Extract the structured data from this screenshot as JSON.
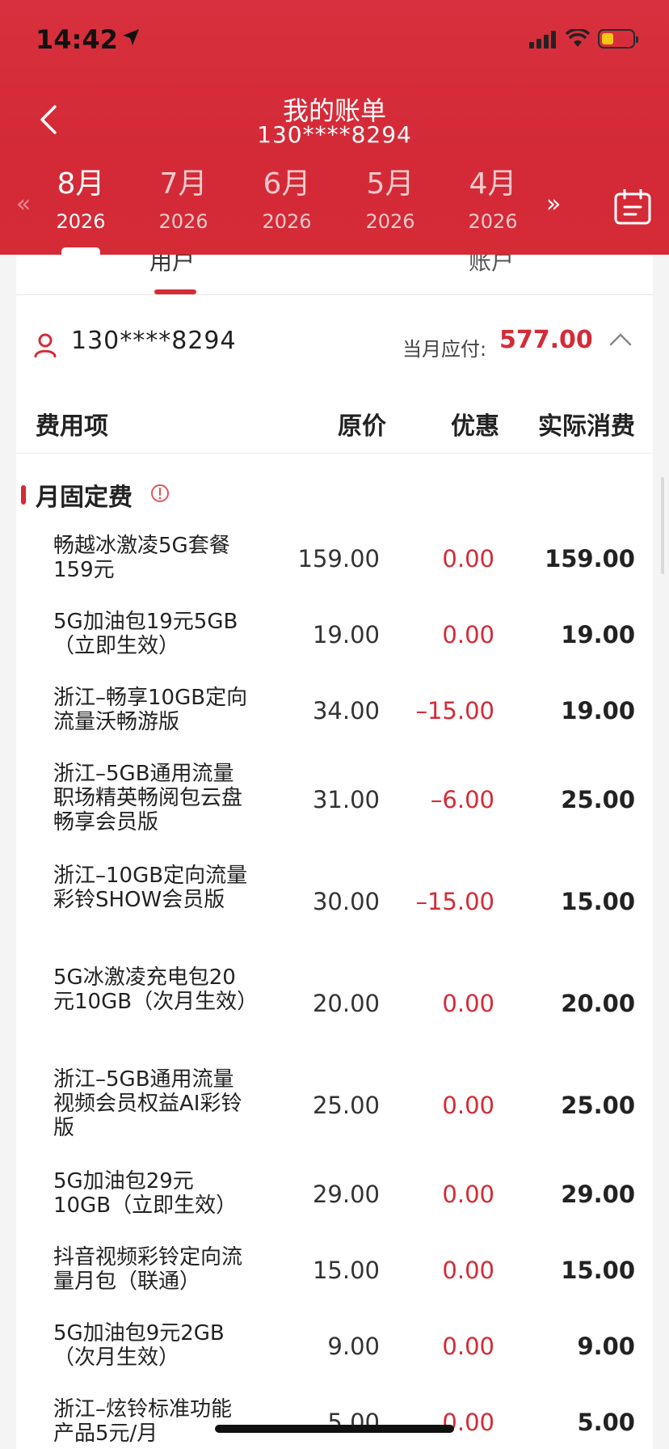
{
  "status": {
    "time": "14:42"
  },
  "header": {
    "title": "我的账单",
    "subtitle": "130****8294"
  },
  "months": [
    {
      "month": "8月",
      "year": "2026"
    },
    {
      "month": "7月",
      "year": "2026"
    },
    {
      "month": "6月",
      "year": "2026"
    },
    {
      "month": "5月",
      "year": "2026"
    },
    {
      "month": "4月",
      "year": "2026"
    }
  ],
  "tabs": {
    "user": "用户",
    "account": "账户"
  },
  "account": {
    "number": "130****8294",
    "due_label": "当月应付:",
    "due_value": "577.00"
  },
  "table_header": {
    "name": "费用项",
    "original": "原价",
    "discount": "优惠",
    "actual": "实际消费"
  },
  "section": {
    "title": "月固定费"
  },
  "rows": [
    {
      "name": "畅越冰激凌5G套餐159元",
      "original": "159.00",
      "discount": "0.00",
      "actual": "159.00"
    },
    {
      "name": "5G加油包19元5GB（立即生效）",
      "original": "19.00",
      "discount": "0.00",
      "actual": "19.00"
    },
    {
      "name": "浙江–畅享10GB定向流量沃畅游版",
      "original": "34.00",
      "discount": "–15.00",
      "actual": "19.00"
    },
    {
      "name": "浙江–5GB通用流量职场精英畅阅包云盘畅享会员版",
      "original": "31.00",
      "discount": "–6.00",
      "actual": "25.00"
    },
    {
      "name": "浙江–10GB定向流量彩铃SHOW会员版",
      "original": "30.00",
      "discount": "–15.00",
      "actual": "15.00"
    },
    {
      "name": "5G冰激凌充电包20元10GB（次月生效）",
      "original": "20.00",
      "discount": "0.00",
      "actual": "20.00"
    },
    {
      "name": "浙江–5GB通用流量视频会员权益AI彩铃版",
      "original": "25.00",
      "discount": "0.00",
      "actual": "25.00"
    },
    {
      "name": "5G加油包29元10GB（立即生效）",
      "original": "29.00",
      "discount": "0.00",
      "actual": "29.00"
    },
    {
      "name": "抖音视频彩铃定向流量月包（联通）",
      "original": "15.00",
      "discount": "0.00",
      "actual": "15.00"
    },
    {
      "name": "5G加油包9元2GB（次月生效）",
      "original": "9.00",
      "discount": "0.00",
      "actual": "9.00"
    },
    {
      "name": "浙江–炫铃标准功能产品5元/月",
      "original": "5.00",
      "discount": "0.00",
      "actual": "5.00"
    }
  ]
}
